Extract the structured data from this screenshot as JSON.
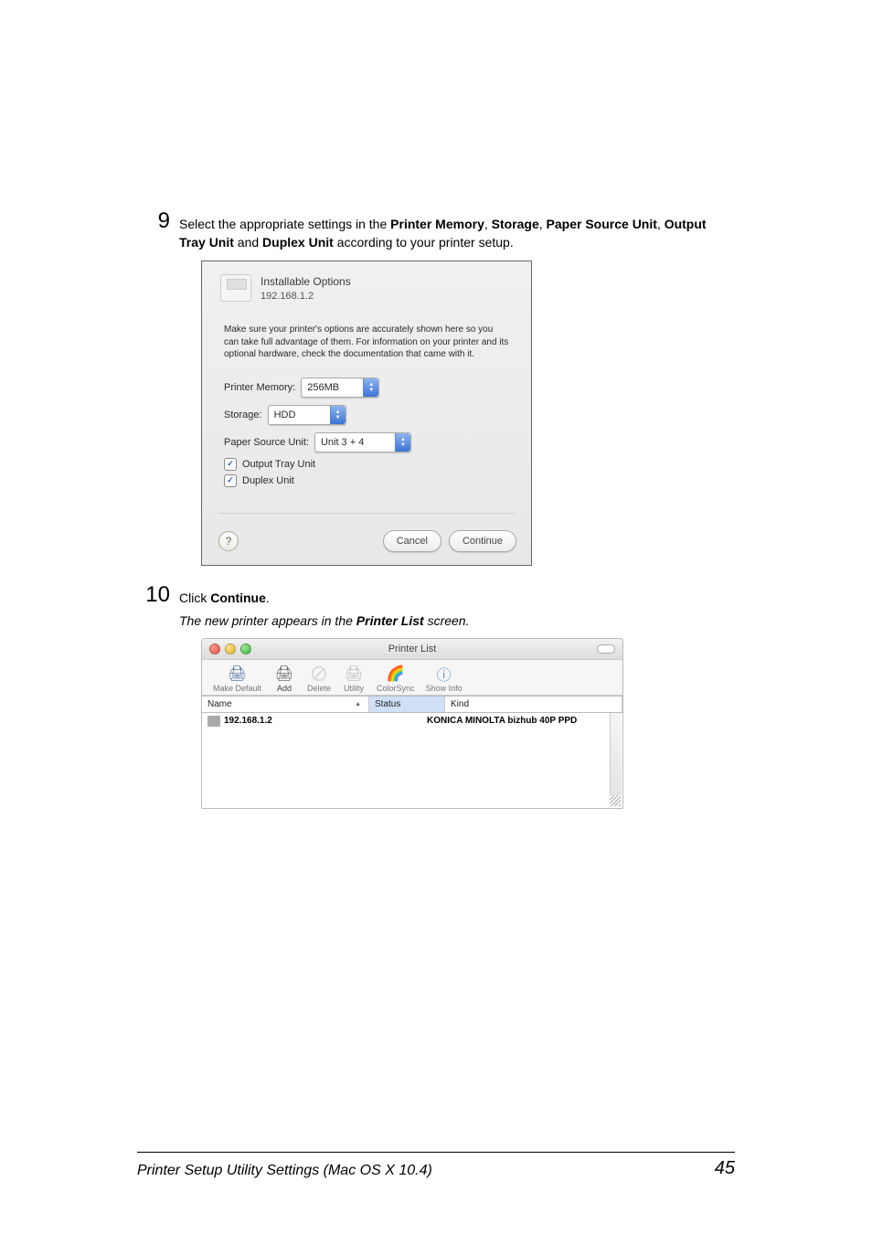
{
  "step9": {
    "num": "9",
    "pre": "Select the appropriate settings in the ",
    "b1": "Printer Memory",
    "sep1": ", ",
    "b2": "Storage",
    "sep2": ", ",
    "b3": "Paper Source Unit",
    "sep3": ", ",
    "b4": "Output Tray Unit",
    "mid": " and ",
    "b5": "Duplex Unit",
    "post": " according to your printer setup."
  },
  "dialog1": {
    "title": "Installable Options",
    "ip": "192.168.1.2",
    "instructions": "Make sure your printer's options are accurately shown here so you can take full advantage of them.  For information on your printer and its optional hardware, check the documentation that came with it.",
    "mem_label": "Printer Memory:",
    "mem_val": "256MB",
    "storage_label": "Storage:",
    "storage_val": "HDD",
    "psu_label": "Paper Source Unit:",
    "psu_val": "Unit 3 + 4",
    "output_tray": "Output Tray Unit",
    "duplex": "Duplex Unit",
    "help": "?",
    "cancel": "Cancel",
    "continue": "Continue"
  },
  "step10": {
    "num": "10",
    "pre": "Click ",
    "btn": "Continue",
    "post": ".",
    "result_pre": "The new printer appears in the ",
    "result_b": "Printer List",
    "result_post": " screen."
  },
  "plist": {
    "title": "Printer List",
    "tools": {
      "make_default": "Make Default",
      "add": "Add",
      "delete": "Delete",
      "utility": "Utility",
      "colorsync": "ColorSync",
      "show_info": "Show Info"
    },
    "cols": {
      "name": "Name",
      "status": "Status",
      "kind": "Kind"
    },
    "row": {
      "name": "192.168.1.2",
      "kind": "KONICA MINOLTA bizhub 40P PPD"
    }
  },
  "footer": {
    "title": "Printer Setup Utility Settings (Mac OS X 10.4)",
    "page": "45"
  }
}
